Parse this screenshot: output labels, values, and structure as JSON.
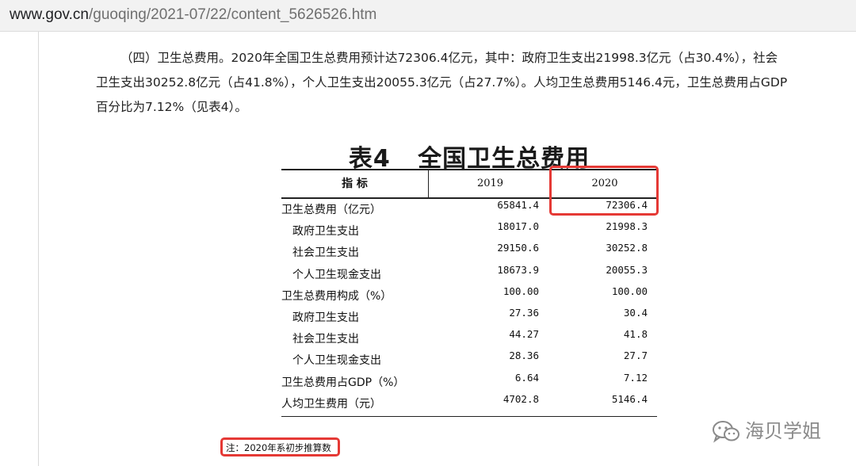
{
  "address_bar": {
    "domain": "www.gov.cn",
    "path": "/guoqing/2021-07/22/content_5626526.htm"
  },
  "article": {
    "line1": "（四）卫生总费用。2020年全国卫生总费用预计达72306.4亿元，其中：政府卫生支出21998.3亿元（占30.4%），社会",
    "line2": "卫生支出30252.8亿元（占41.8%），个人卫生支出20055.3亿元（占27.7%）。人均卫生总费用5146.4元，卫生总费用占GDP",
    "line3": "百分比为7.12%（见表4）。"
  },
  "table": {
    "title": "表4   全国卫生总费用",
    "headers": [
      "指  标",
      "2019",
      "2020"
    ],
    "rows": [
      {
        "label": "卫生总费用（亿元）",
        "v2019": "65841.4",
        "v2020": "72306.4"
      },
      {
        "label": "政府卫生支出",
        "v2019": "18017.0",
        "v2020": "21998.3"
      },
      {
        "label": "社会卫生支出",
        "v2019": "29150.6",
        "v2020": "30252.8"
      },
      {
        "label": "个人卫生现金支出",
        "v2019": "18673.9",
        "v2020": "20055.3"
      },
      {
        "label": "卫生总费用构成（%）",
        "v2019": "100.00",
        "v2020": "100.00"
      },
      {
        "label": "政府卫生支出",
        "v2019": "27.36",
        "v2020": "30.4"
      },
      {
        "label": "社会卫生支出",
        "v2019": "44.27",
        "v2020": "41.8"
      },
      {
        "label": "个人卫生现金支出",
        "v2019": "28.36",
        "v2020": "27.7"
      },
      {
        "label": "卫生总费用占GDP（%）",
        "v2019": "6.64",
        "v2020": "7.12"
      },
      {
        "label": "人均卫生费用（元）",
        "v2019": "4702.8",
        "v2020": "5146.4"
      }
    ],
    "note": "注：2020年系初步推算数"
  },
  "watermark": {
    "text": "海贝学姐",
    "icon": "wechat-icon"
  },
  "colors": {
    "highlight": "#e53935",
    "urlbar_bg": "#f2f2f2"
  }
}
